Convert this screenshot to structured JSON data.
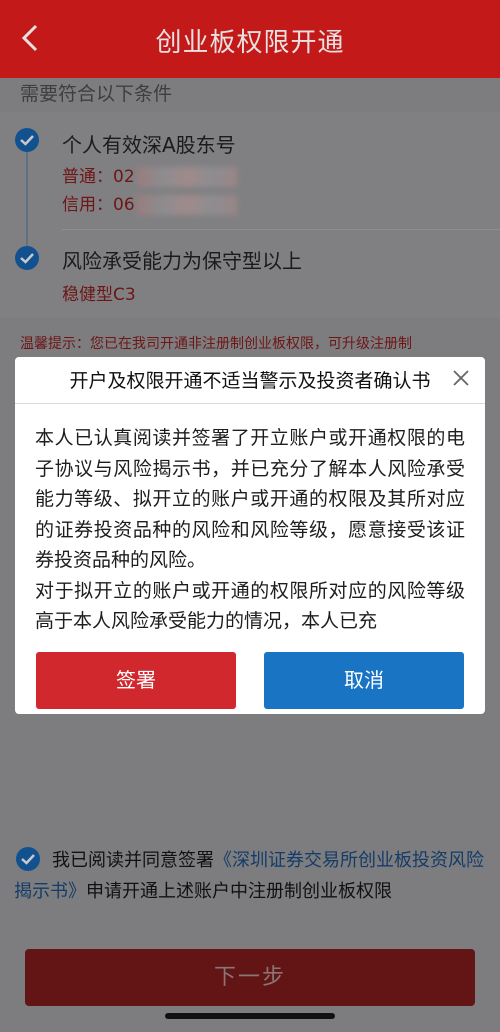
{
  "header": {
    "title": "创业板权限开通"
  },
  "section_label": "需要符合以下条件",
  "conditions": [
    {
      "title": "个人有效深A股东号",
      "lines": [
        "普通：02",
        "信用：06"
      ]
    },
    {
      "title": "风险承受能力为保守型以上",
      "detail": "稳健型C3"
    }
  ],
  "tip": "温馨提示：您已在我司开通非注册制创业板权限，可升级注册制",
  "modal": {
    "title": "开户及权限开通不适当警示及投资者确认书",
    "paragraph1": "本人已认真阅读并签署了开立账户或开通权限的电子协议与风险揭示书，并已充分了解本人风险承受能力等级、拟开立的账户或开通的权限及其所对应的证券投资品种的风险和风险等级，愿意接受该证券投资品种的风险。",
    "paragraph2": "对于拟开立的账户或开通的权限所对应的风险等级高于本人风险承受能力的情况，本人已充",
    "sign_label": "签署",
    "cancel_label": "取消"
  },
  "agreement": {
    "prefix": "我已阅读并同意签署",
    "link": "《深圳证券交易所创业板投资风险揭示书》",
    "suffix": "申请开通上述账户中注册制创业板权限"
  },
  "next_label": "下一步",
  "colors": {
    "brand_red": "#c31a19",
    "accent_blue": "#1a74c4",
    "check_blue": "#12518f"
  }
}
